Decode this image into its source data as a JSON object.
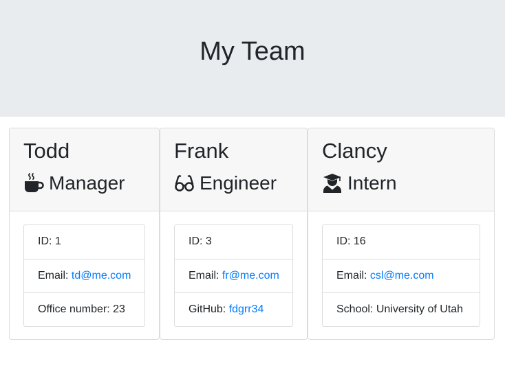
{
  "header": {
    "title": "My Team"
  },
  "colors": {
    "link": "#007bff",
    "jumbotron_bg": "#e9ecef",
    "card_header_bg": "#f7f7f7"
  },
  "cards": [
    {
      "name": "Todd",
      "role": "Manager",
      "role_icon": "coffee-mug-icon",
      "id_text": "ID: 1",
      "email_label": "Email: ",
      "email": "td@me.com",
      "extra_text": "Office number: 23"
    },
    {
      "name": "Frank",
      "role": "Engineer",
      "role_icon": "glasses-icon",
      "id_text": "ID: 3",
      "email_label": "Email: ",
      "email": "fr@me.com",
      "extra_label": "GitHub: ",
      "extra_link": "fdgrr34"
    },
    {
      "name": "Clancy",
      "role": "Intern",
      "role_icon": "graduate-icon",
      "id_text": "ID: 16",
      "email_label": "Email: ",
      "email": "csl@me.com",
      "extra_text": "School: University of Utah"
    }
  ]
}
